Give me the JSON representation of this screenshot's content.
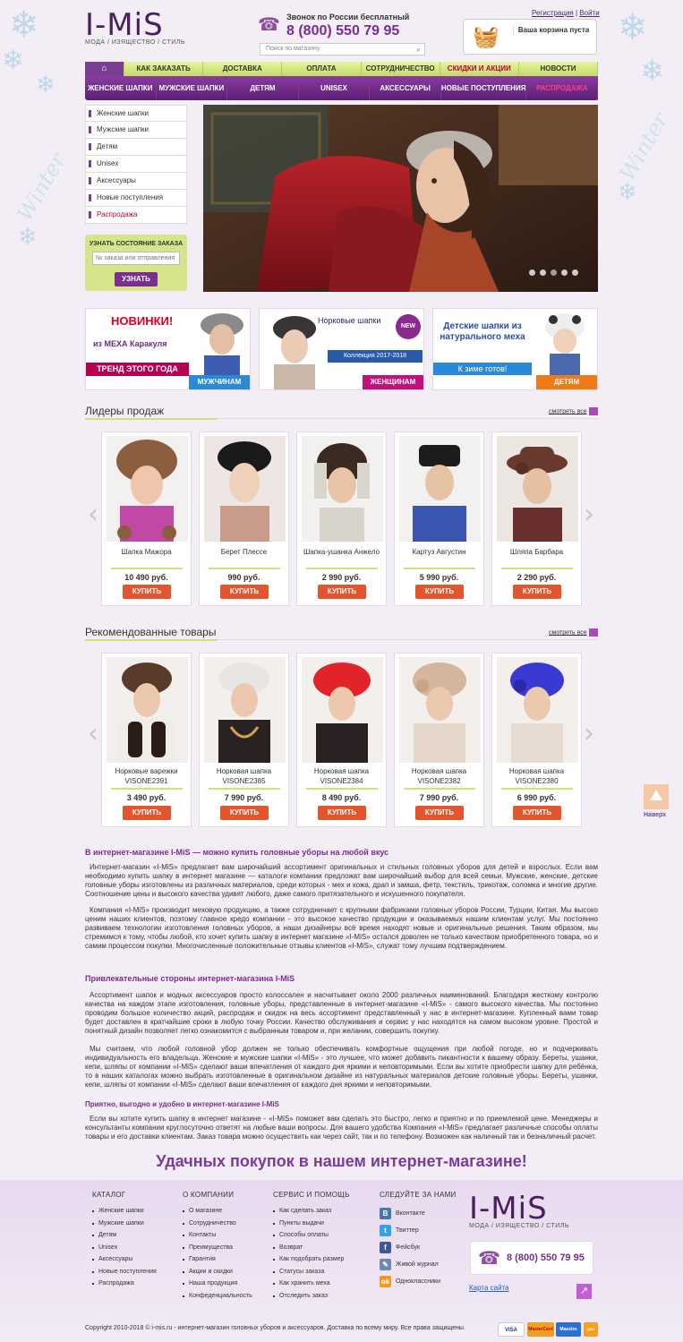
{
  "header": {
    "logo_text": "I-MiS",
    "logo_tagline": "МОДА / ИЗЯЩЕСТВО / СТИЛЬ",
    "phone_label": "Звонок по России бесплатный",
    "phone_number": "8 (800) 550 79 95",
    "search_placeholder": "Поиск по магазину",
    "register_link": "Регистрация",
    "login_link": "Войти",
    "cart_text": "Ваша корзина пуста"
  },
  "nav_top": [
    "КАК ЗАКАЗАТЬ",
    "ДОСТАВКА",
    "ОПЛАТА",
    "СОТРУДНИЧЕСТВО",
    "СКИДКИ И АКЦИИ",
    "НОВОСТИ"
  ],
  "nav_main": [
    "ЖЕНСКИЕ ШАПКИ",
    "МУЖСКИЕ ШАПКИ",
    "ДЕТЯМ",
    "UNISEX",
    "АКСЕССУАРЫ",
    "НОВЫЕ ПОСТУПЛЕНИЯ",
    "РАСПРОДАЖА"
  ],
  "sidebar": [
    "Женские шапки",
    "Мужские шапки",
    "Детям",
    "Unisex",
    "Аксессуары",
    "Новые поступления",
    "Распродажа"
  ],
  "order_status": {
    "title": "УЗНАТЬ СОСТОЯНИЕ ЗАКАЗА",
    "placeholder": "№ заказа или отправления",
    "button": "УЗНАТЬ"
  },
  "banners": [
    {
      "title": "НОВИНКИ!",
      "subtitle": "из МЕХА Каракуля",
      "strip": "ТРЕНД ЭТОГО ГОДА",
      "tag": "МУЖЧИНАМ"
    },
    {
      "title": "Норковые шапки",
      "badge": "NEW",
      "subtitle": "Коллекция 2017-2018",
      "tag": "ЖЕНЩИНАМ"
    },
    {
      "title": "Детские шапки из натурального меха",
      "subtitle": "К зиме готов!",
      "tag": "ДЕТЯМ"
    }
  ],
  "bestsellers": {
    "title": "Лидеры продаж",
    "see_all": "смотреть все",
    "items": [
      {
        "name": "Шапка Мажора",
        "price": "10 490 руб.",
        "button": "КУПИТЬ"
      },
      {
        "name": "Берет Плессе",
        "price": "990 руб.",
        "button": "КУПИТЬ"
      },
      {
        "name": "Шапка-ушанка Анжело",
        "price": "2 990 руб.",
        "button": "КУПИТЬ"
      },
      {
        "name": "Картуз Августин",
        "price": "5 990 руб.",
        "button": "КУПИТЬ"
      },
      {
        "name": "Шляпа Барбара",
        "price": "2 290 руб.",
        "button": "КУПИТЬ"
      }
    ]
  },
  "recommended": {
    "title": "Рекомендованные товары",
    "see_all": "смотреть все",
    "items": [
      {
        "name": "Норковые варежки",
        "code": "VISONE2391",
        "price": "3 490 руб.",
        "button": "КУПИТЬ"
      },
      {
        "name": "Норковая шапка",
        "code": "VISONE2385",
        "price": "7 990 руб.",
        "button": "КУПИТЬ"
      },
      {
        "name": "Норковая шапка",
        "code": "VISONE2384",
        "price": "8 490 руб.",
        "button": "КУПИТЬ"
      },
      {
        "name": "Норковая шапка",
        "code": "VISONE2382",
        "price": "7 990 руб.",
        "button": "КУПИТЬ"
      },
      {
        "name": "Норковая шапка",
        "code": "VISONE2380",
        "price": "6 990 руб.",
        "button": "КУПИТЬ"
      }
    ]
  },
  "scroll_up": "Наверх",
  "article": {
    "h1": "В интернет-магазине I-MiS — можно купить головные уборы на любой вкус",
    "p1": "Интернет-магазин «I-MiS» предлагает вам широчайший ассортимент оригинальных и стильных головных уборов для детей и взрослых. Если вам необходимо купить шапку в интернет магазине — каталоги компании предложат вам широчайший выбор для всей семьи. Мужские, женские, детские головные уборы изготовлены из различных материалов, среди которых - мех и кожа, драп и замша, фетр, текстиль, трикотаж, соломка и многие другие. Соотношение цены и высокого качества удивят любого, даже самого притязательного и искушенного покупателя.",
    "p2": "Компания «I-MiS» производит меховую продукцию, а также сотрудничает с крупными фабриками головных уборов России, Турции, Китая. Мы высоко ценим наших клиентов, поэтому главное кредо компании - это высокое качество продукции и оказываемых нашим клиентам услуг. Мы постоянно развиваем технологии изготовления головных уборов, а наши дизайнеры всё время находят новые и оригинальные решения. Таким образом, мы стремимся к тому, чтобы любой, кто хочет купить шапку в интернет магазине «I-MiS» остался доволен не только качеством приобретенного товара, но и самим процессом покупки. Многочисленные положительные отзывы клиентов «I-MiS», служат тому лучшим подтверждением.",
    "h2": "Привлекательные стороны интернет-магазина I-MiS",
    "p3": "Ассортимент шапок и модных аксессуаров просто колоссален и насчитывает около 2000 различных наименований. Благодаря жесткому контролю качества на каждом этапе изготовления, головные уборы, представленные в интернет-магазине «I-MiS» - самого высокого качества. Мы постоянно проводим большое количество акций, распродаж и скидок на весь ассортимент представленный у нас в интернет-магазине. Купленный вами товар будет доставлен в кратчайшие сроки в любую точку России. Качество обслуживания и сервис у нас находятся на самом высоком уровне. Простой и понятный дизайн позволяет легко ознакомится с выбранным товаром и, при желании, совершить покупку.",
    "p4": "Мы считаем, что любой головной убор должен не только обеспечивать комфортные ощущения при любой погоде, но и подчеркивать индивидуальность его владельца. Женские и мужские шапки «I-MiS» - это лучшее, что может добавить пикантности к вашему образу. Береты, ушанки, кепи, шляпы от компании «I-MiS» сделают ваши впечатления от каждого дня яркими и неповторимыми. Если вы хотите приобрести шапку для ребёнка, то в наших каталогах можно выбрать изготовленные в оригинальном дизайне из натуральных материалов детские головные уборы. Береты, ушанки, кепи, шляпы от компании «I-MiS» сделают ваши впечатления от каждого дня яркими и неповторимыми.",
    "h3": "Приятно, выгодно и удобно в интернет-магазине I-MiS",
    "p5": "Если вы хотите купить шапку в интернет магазине - «I-MiS» поможет вам сделать это быстро, легко и приятно и по приемлемой цене. Менеджеры и консультанты компании круглосуточно ответят на любые ваши вопросы. Для вашего удобства Компания «I-MiS» предлагает различные способы оплаты товары и его доставки клиентам. Заказ товара можно осуществить как через сайт, так и по телефону. Возможен как наличный так и безналичный расчет.",
    "slogan": "Удачных покупок в нашем интернет-магазине!"
  },
  "footer": {
    "catalog_title": "КАТАЛОГ",
    "catalog": [
      "Женские шапки",
      "Мужские шапки",
      "Детям",
      "Unisex",
      "Аксессуары",
      "Новые поступления",
      "Распродажа"
    ],
    "company_title": "О КОМПАНИИ",
    "company": [
      "О магазине",
      "Сотрудничество",
      "Контакты",
      "Преимущества",
      "Гарантия",
      "Акции и скидки",
      "Наша продукция",
      "Конфеденциальность"
    ],
    "service_title": "СЕРВИС И ПОМОЩЬ",
    "service": [
      "Как сделать заказ",
      "Пункты выдачи",
      "Способы оплаты",
      "Возврат",
      "Как подобрать размер",
      "Статусы заказа",
      "Как хранить меха",
      "Отследить заказ"
    ],
    "social_title": "СЛЕДУЙТЕ ЗА НАМИ",
    "social": [
      "Вконтакте",
      "Твиттер",
      "Фейсбук",
      "Живой журнал",
      "Одноклассники"
    ],
    "phone": "8 (800) 550 79 95",
    "map_link": "Карта сайта",
    "copyright": "Copyright 2010-2018 © i-mis.ru - интернет-магазин головных уборов и аксессуаров. Доставка по всему миру. Все права защищены.",
    "payments": [
      "VISA",
      "MasterCard",
      "Maestro",
      "QIWI"
    ]
  },
  "colors": {
    "purple": "#7a2e8e",
    "green": "#d1e07a",
    "buy": "#e3562d",
    "sale": "#c0003c"
  }
}
